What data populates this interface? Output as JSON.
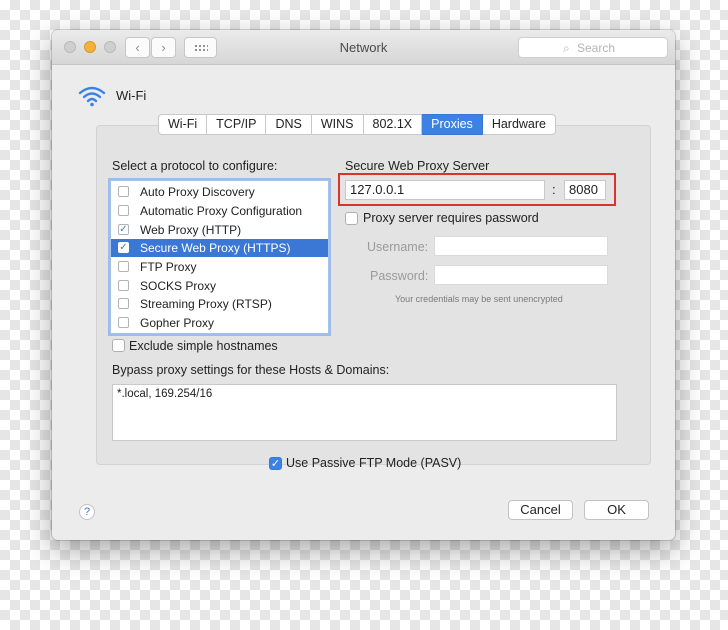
{
  "window": {
    "title": "Network"
  },
  "search": {
    "placeholder": "Search",
    "icon": "search-icon"
  },
  "interface": {
    "name": "Wi-Fi",
    "icon": "wifi-icon"
  },
  "tabs": [
    {
      "label": "Wi-Fi",
      "active": false
    },
    {
      "label": "TCP/IP",
      "active": false
    },
    {
      "label": "DNS",
      "active": false
    },
    {
      "label": "WINS",
      "active": false
    },
    {
      "label": "802.1X",
      "active": false
    },
    {
      "label": "Proxies",
      "active": true
    },
    {
      "label": "Hardware",
      "active": false
    }
  ],
  "protocols": {
    "heading": "Select a protocol to configure:",
    "items": [
      {
        "label": "Auto Proxy Discovery",
        "checked": false,
        "selected": false
      },
      {
        "label": "Automatic Proxy Configuration",
        "checked": false,
        "selected": false
      },
      {
        "label": "Web Proxy (HTTP)",
        "checked": true,
        "selected": false
      },
      {
        "label": "Secure Web Proxy (HTTPS)",
        "checked": true,
        "selected": true
      },
      {
        "label": "FTP Proxy",
        "checked": false,
        "selected": false
      },
      {
        "label": "SOCKS Proxy",
        "checked": false,
        "selected": false
      },
      {
        "label": "Streaming Proxy (RTSP)",
        "checked": false,
        "selected": false
      },
      {
        "label": "Gopher Proxy",
        "checked": false,
        "selected": false
      }
    ]
  },
  "proxy_server": {
    "heading": "Secure Web Proxy Server",
    "host": "127.0.0.1",
    "separator": ":",
    "port": "8080",
    "requires_password_label": "Proxy server requires password",
    "requires_password": false,
    "username_label": "Username:",
    "username": "",
    "password_label": "Password:",
    "password": "",
    "note": "Your credentials may be sent unencrypted"
  },
  "exclude_simple": {
    "label": "Exclude simple hostnames",
    "checked": false
  },
  "bypass": {
    "label": "Bypass proxy settings for these Hosts & Domains:",
    "value": "*.local, 169.254/16"
  },
  "passive_ftp": {
    "label": "Use Passive FTP Mode (PASV)",
    "checked": true
  },
  "buttons": {
    "help": "?",
    "cancel": "Cancel",
    "ok": "OK"
  },
  "colors": {
    "accent": "#3b82e4",
    "highlight_border": "#d9342b"
  }
}
